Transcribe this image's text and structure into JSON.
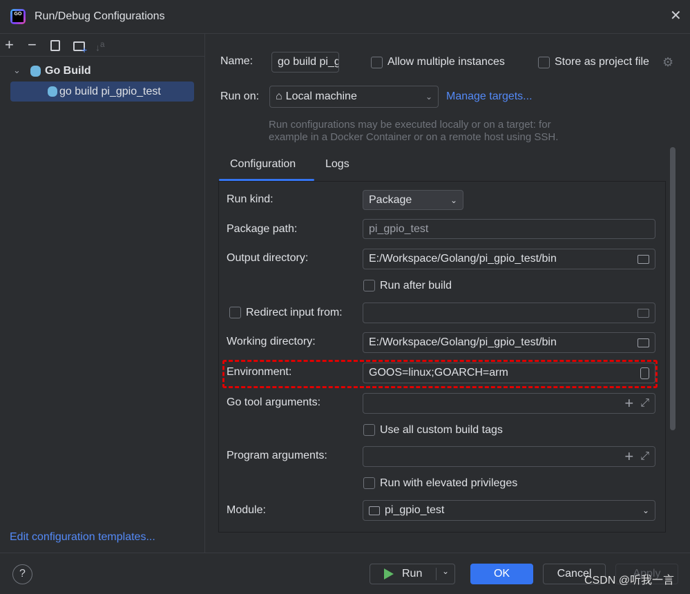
{
  "window": {
    "title": "Run/Debug Configurations",
    "app_icon": "goland-logo",
    "close_icon": "close-icon"
  },
  "sidebar": {
    "toolbar": [
      "add-icon",
      "remove-icon",
      "copy-icon",
      "new-folder-icon",
      "sort-icon"
    ],
    "tree": {
      "group": "Go Build",
      "items": [
        {
          "label": "go build pi_gpio_test",
          "selected": true
        }
      ]
    },
    "edit_templates": "Edit configuration templates..."
  },
  "header": {
    "name_label": "Name:",
    "name_value": "go build pi_gpio_test",
    "allow_multiple": "Allow multiple instances",
    "allow_multiple_checked": false,
    "store_project": "Store as project file",
    "store_project_checked": false,
    "run_on_label": "Run on:",
    "run_on_value": "Local machine",
    "manage_targets": "Manage targets...",
    "hint1": "Run configurations may be executed locally or on a target: for",
    "hint2": "example in a Docker Container or on a remote host using SSH."
  },
  "tabs": [
    {
      "label": "Configuration",
      "active": true
    },
    {
      "label": "Logs",
      "active": false
    }
  ],
  "form": {
    "run_kind_label": "Run kind:",
    "run_kind_value": "Package",
    "package_path_label": "Package path:",
    "package_path_value": "pi_gpio_test",
    "output_dir_label": "Output directory:",
    "output_dir_value": "E:/Workspace/Golang/pi_gpio_test/bin",
    "run_after_build": "Run after build",
    "run_after_build_checked": false,
    "redirect_label": "Redirect input from:",
    "redirect_checked": false,
    "redirect_value": "",
    "working_dir_label": "Working directory:",
    "working_dir_value": "E:/Workspace/Golang/pi_gpio_test/bin",
    "environment_label": "Environment:",
    "environment_value": "GOOS=linux;GOARCH=arm",
    "go_tool_args_label": "Go tool arguments:",
    "go_tool_args_value": "",
    "custom_tags": "Use all custom build tags",
    "custom_tags_checked": false,
    "program_args_label": "Program arguments:",
    "program_args_value": "",
    "elevated": "Run with elevated privileges",
    "elevated_checked": false,
    "module_label": "Module:",
    "module_value": "pi_gpio_test"
  },
  "footer": {
    "help": "?",
    "run": "Run",
    "ok": "OK",
    "cancel": "Cancel",
    "apply": "Apply",
    "accent": "#3574f0"
  },
  "watermark": "CSDN @听我一言"
}
